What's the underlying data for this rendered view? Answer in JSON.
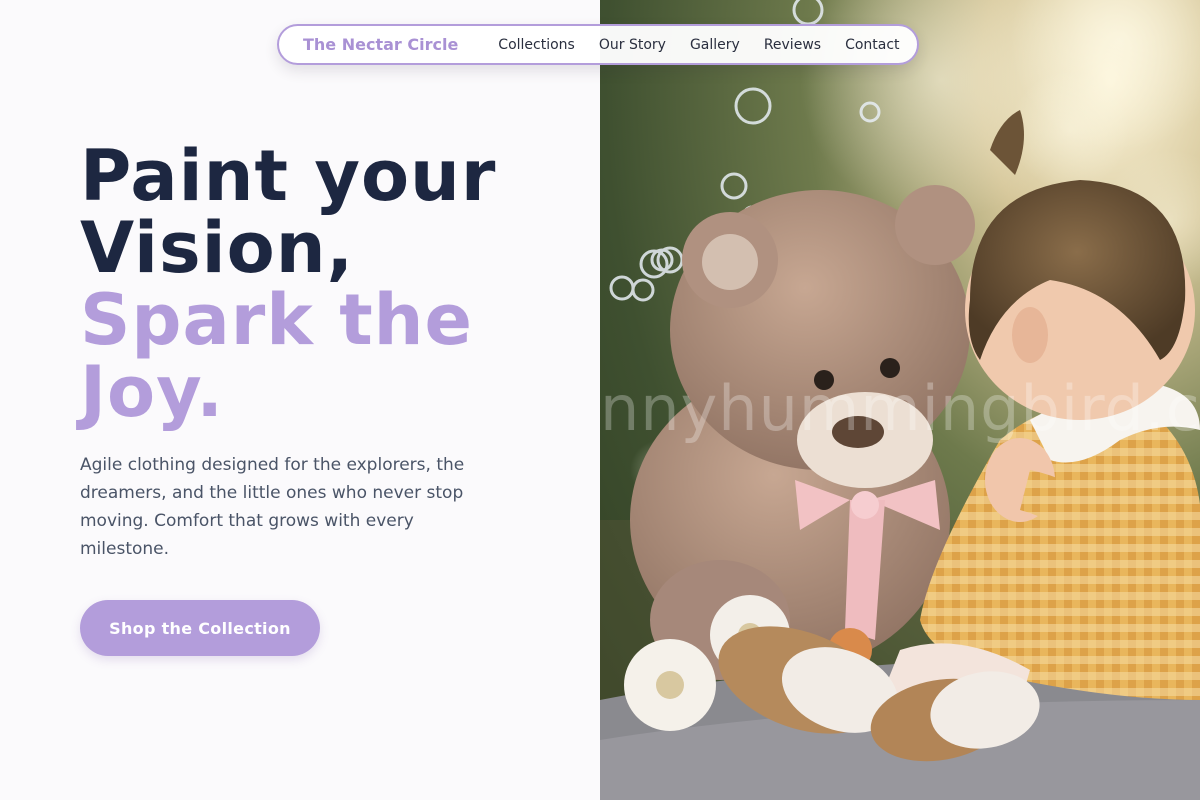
{
  "nav": {
    "brand": "The Nectar Circle",
    "links": [
      "Collections",
      "Our Story",
      "Gallery",
      "Reviews",
      "Contact"
    ]
  },
  "hero": {
    "headline_dark_line1": "Paint your",
    "headline_dark_line2": "Vision,",
    "headline_accent_line1": "Spark the",
    "headline_accent_line2": "Joy.",
    "description": "Agile clothing designed for the explorers, the dreamers, and the little ones who never stop moving. Comfort that grows with every milestone.",
    "cta_label": "Shop the Collection"
  },
  "image": {
    "watermark": "nnyhummingbird.c"
  },
  "colors": {
    "accent": "#b39ddb",
    "brand_text": "#a991d4",
    "headline_dark": "#1d2741",
    "body_text": "#4a5467",
    "background": "#fbfafc"
  }
}
